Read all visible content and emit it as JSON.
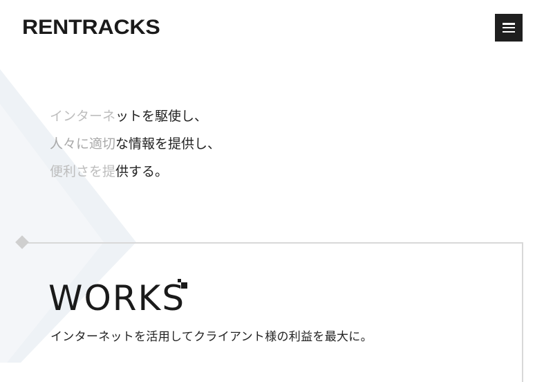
{
  "header": {
    "logo_text": "RENTRACKS",
    "menu_icon": "hamburger-menu-icon"
  },
  "tagline": {
    "line1_faded": "インターネ",
    "line1_rest": "ットを駆使し、",
    "line2_faded": "人々に適切",
    "line2_rest": "な情報を提供し、",
    "line3_faded": "便利さを提",
    "line3_rest": "供する。"
  },
  "works": {
    "title": "WORKS",
    "subtitle": "インターネットを活用してクライアント様の利益を最大に。"
  },
  "colors": {
    "menu_bg": "#1f1f1f",
    "bg_shape": "#eef2f6",
    "frame_line": "#d8d8d8"
  }
}
